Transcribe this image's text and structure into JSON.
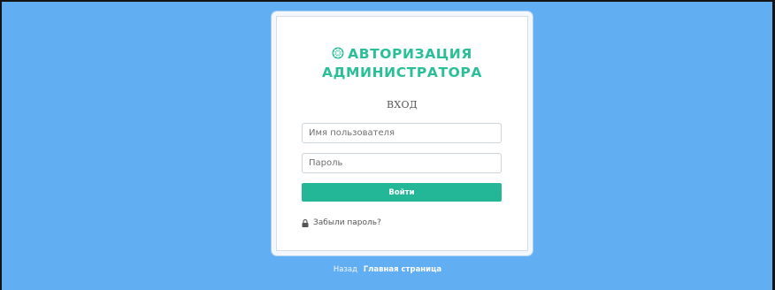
{
  "login": {
    "title_icon": "dharmachakra-icon",
    "title_line1": "АВТОРИЗАЦИЯ",
    "title_line2": "АДМИНИСТРАТОРА",
    "subtitle": "ВХОД",
    "username_placeholder": "Имя пользователя",
    "username_value": "",
    "password_placeholder": "Пароль",
    "password_value": "",
    "submit_label": "Войти",
    "forgot_icon": "lock-icon",
    "forgot_label": "Забыли пароль?"
  },
  "footer": {
    "back_label": "Назад",
    "home_label": "Главная страница"
  },
  "colors": {
    "background": "#62aef3",
    "accent": "#2abf98",
    "button": "#23b797",
    "card": "#ffffff"
  }
}
